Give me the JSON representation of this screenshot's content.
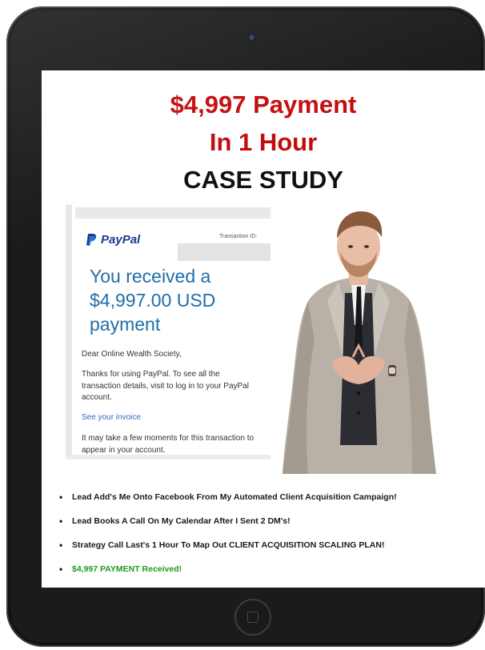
{
  "headline": {
    "line1": "$4,997 Payment",
    "line2": "In 1 Hour",
    "line3": "CASE STUDY"
  },
  "colors": {
    "headline_red": "#c20c0c",
    "paypal_blue": "#1b3a8c",
    "paypal_light_blue": "#2a7ad9",
    "payment_text_blue": "#1f6ea8",
    "link_blue": "#2f6fc0",
    "success_green": "#1e9a1e",
    "tablet_bezel": "#1b1b1d"
  },
  "paypal_receipt": {
    "logo_text": "PayPal",
    "transaction_label": "Transaction ID:",
    "received_message": "You received a $4,997.00 USD payment",
    "greeting": "Dear Online Wealth Society,",
    "body": "Thanks for using PayPal. To see all the transaction details, visit  to log in to your PayPal account.",
    "invoice_link": "See your invoice",
    "footer_note": "It may take a few moments for this transaction to appear in your account."
  },
  "bullets": [
    "Lead Add's Me Onto Facebook From My Automated Client Acquisition Campaign!",
    "Lead Books A Call On My Calendar After I Sent 2 DM's!",
    "Strategy Call Last's 1 Hour To Map Out CLIENT ACQUISITION SCALING PLAN!",
    "$4,997 PAYMENT Received!"
  ],
  "icons": {
    "paypal_mark": "paypal-p-icon",
    "camera": "front-camera-icon",
    "home": "home-button-icon"
  }
}
